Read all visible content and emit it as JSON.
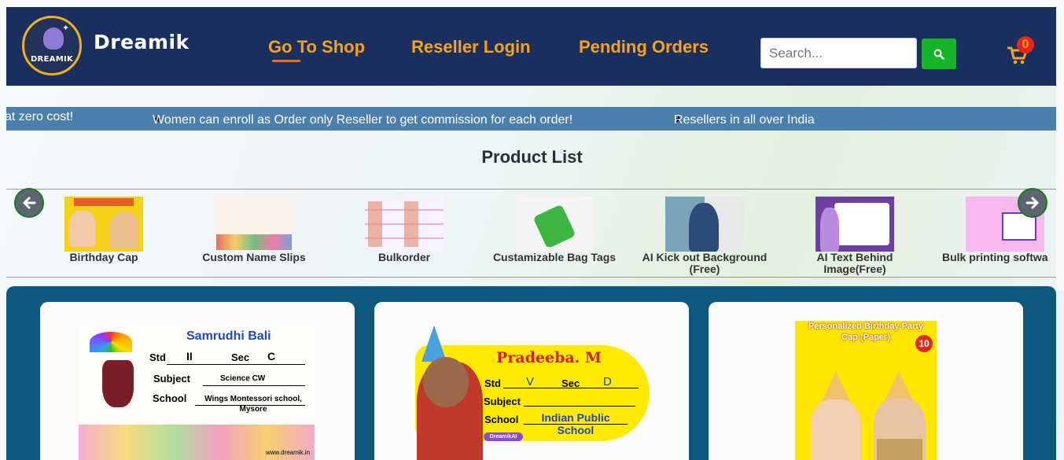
{
  "header": {
    "logo_text": "DREAMIK",
    "brand": "Dreamik",
    "nav": [
      {
        "label": "Go To Shop"
      },
      {
        "label": "Reseller Login"
      },
      {
        "label": "Pending Orders"
      }
    ],
    "search": {
      "placeholder": "Search..."
    },
    "cart": {
      "count": "0"
    }
  },
  "marquee": {
    "items": [
      "at zero cost!",
      "Women can enroll as Order only Reseller to get commission for each order!",
      "Resellers in all over India"
    ]
  },
  "product_list": {
    "title": "Product List",
    "items": [
      {
        "label": "Birthday Cap"
      },
      {
        "label": "Custom Name Slips"
      },
      {
        "label": "Bulkorder"
      },
      {
        "label": "Custamizable Bag Tags"
      },
      {
        "label": "AI Kick out Background (Free)"
      },
      {
        "label": "AI Text Behind Image(Free)"
      },
      {
        "label": "Bulk printing softwa"
      }
    ]
  },
  "cards": [
    {
      "name": "Samrudhi Bali",
      "std": "II",
      "sec": "C",
      "subject": "Science CW",
      "school": "Wings Montessori school, Mysore",
      "std_label": "Std",
      "sec_label": "Sec",
      "subject_label": "Subject",
      "school_label": "School",
      "url": "www.dreamik.in"
    },
    {
      "name": "Pradeeba. M",
      "std": "V",
      "sec": "D",
      "school": "Indian Public School",
      "std_label": "Std",
      "sec_label": "Sec",
      "subject_label": "Subject",
      "school_label": "School",
      "brand": "DreamikAI"
    },
    {
      "title": "Personalized Birthday Party Cap (Paper)",
      "badge": "10"
    }
  ],
  "colors": {
    "header_bg": "#1b2f5e",
    "nav_text": "#f6a21a",
    "marquee_bg": "#4b7fad",
    "cards_bg": "#0d587e",
    "search_btn": "#16b528",
    "cart_badge": "#e8251d"
  }
}
